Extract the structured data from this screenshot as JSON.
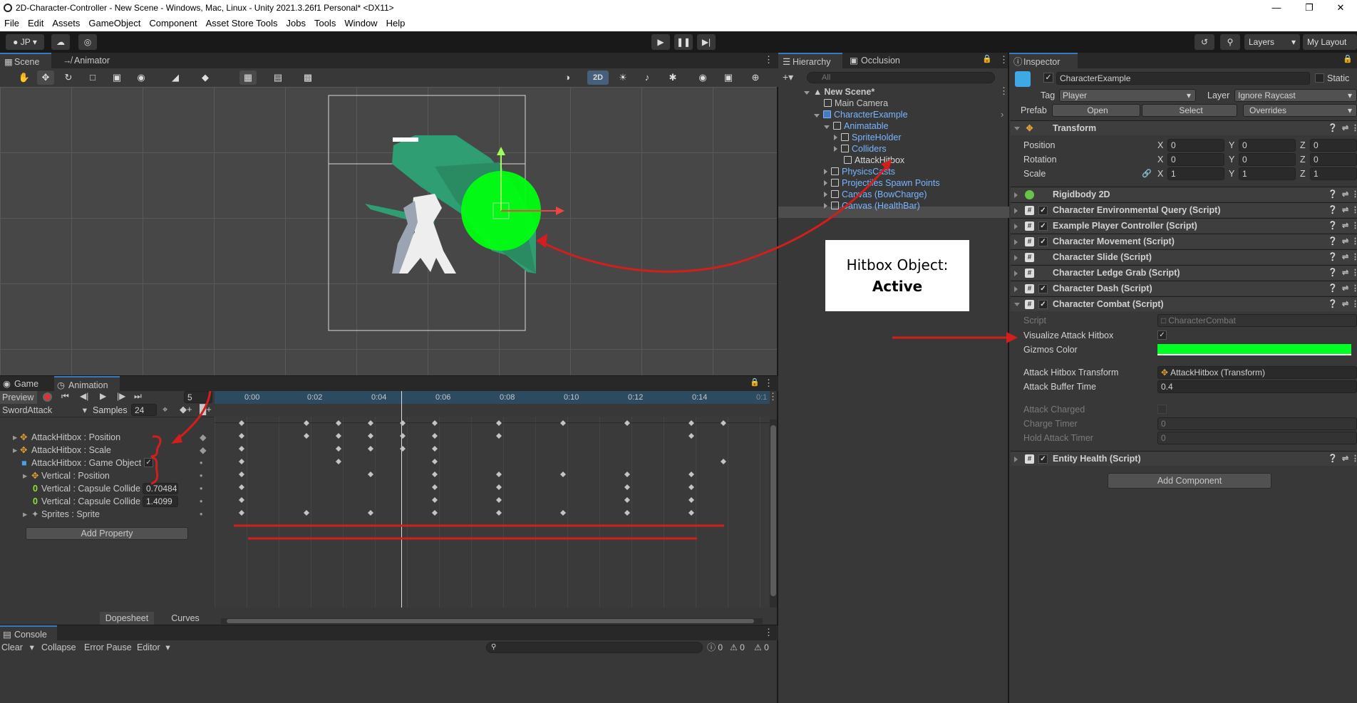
{
  "window": {
    "title": "2D-Character-Controller - New Scene - Windows, Mac, Linux - Unity 2021.3.26f1 Personal* <DX11>"
  },
  "menu": [
    "File",
    "Edit",
    "Assets",
    "GameObject",
    "Component",
    "Asset Store Tools",
    "Jobs",
    "Tools",
    "Window",
    "Help"
  ],
  "toolbar": {
    "account": "JP",
    "layers": "Layers",
    "layout": "My Layout"
  },
  "scene_tabs": {
    "scene": "Scene",
    "animator": "Animator",
    "mode_2d": "2D"
  },
  "hierarchy": {
    "tab": "Hierarchy",
    "tab2": "Occlusion",
    "search_placeholder": "All",
    "items": [
      {
        "label": "New Scene*"
      },
      {
        "label": "Main Camera"
      },
      {
        "label": "CharacterExample"
      },
      {
        "label": "Animatable"
      },
      {
        "label": "SpriteHolder"
      },
      {
        "label": "Colliders"
      },
      {
        "label": "AttackHitbox"
      },
      {
        "label": "PhysicsCasts"
      },
      {
        "label": "Projectiles Spawn Points"
      },
      {
        "label": "Canvas (BowCharge)"
      },
      {
        "label": "Canvas (HealthBar)"
      }
    ]
  },
  "annotation": {
    "line1": "Hitbox Object:",
    "line2": "Active"
  },
  "inspector": {
    "tab": "Inspector",
    "object_name": "CharacterExample",
    "static": "Static",
    "tag_label": "Tag",
    "tag_value": "Player",
    "layer_label": "Layer",
    "layer_value": "Ignore Raycast",
    "prefab_label": "Prefab",
    "open": "Open",
    "select": "Select",
    "overrides": "Overrides",
    "transform": {
      "title": "Transform",
      "position": {
        "label": "Position",
        "x": "0",
        "y": "0",
        "z": "0"
      },
      "rotation": {
        "label": "Rotation",
        "x": "0",
        "y": "0",
        "z": "0"
      },
      "scale": {
        "label": "Scale",
        "x": "1",
        "y": "1",
        "z": "1"
      },
      "axes": [
        "X",
        "Y",
        "Z"
      ]
    },
    "components": [
      "Rigidbody 2D",
      "Character Environmental Query (Script)",
      "Example Player Controller (Script)",
      "Character Movement (Script)",
      "Character Slide (Script)",
      "Character Ledge Grab (Script)",
      "Character Dash (Script)",
      "Character Combat (Script)",
      "Entity Health (Script)"
    ],
    "combat": {
      "script_label": "Script",
      "script_value": "CharacterCombat",
      "visualize_label": "Visualize Attack Hitbox",
      "gizmos_label": "Gizmos Color",
      "gizmos_color": "#00ff22",
      "hitbox_transform_label": "Attack Hitbox Transform",
      "hitbox_transform_value": "AttackHitbox (Transform)",
      "buffer_label": "Attack Buffer Time",
      "buffer_value": "0.4",
      "charged_label": "Attack Charged",
      "charge_timer_label": "Charge Timer",
      "charge_timer_value": "0",
      "hold_timer_label": "Hold Attack Timer",
      "hold_timer_value": "0"
    },
    "add_component": "Add Component"
  },
  "animation": {
    "tab_game": "Game",
    "tab_anim": "Animation",
    "preview": "Preview",
    "frame": "5",
    "clip": "SwordAttack",
    "samples_label": "Samples",
    "samples": "24",
    "times": [
      "0:00",
      "0:02",
      "0:04",
      "0:06",
      "0:08",
      "0:10",
      "0:12",
      "0:14",
      "0:1"
    ],
    "properties": [
      {
        "label": "AttackHitbox : Position",
        "value": ""
      },
      {
        "label": "AttackHitbox : Scale",
        "value": ""
      },
      {
        "label": "AttackHitbox : Game Object",
        "value": ""
      },
      {
        "label": "Vertical : Position",
        "value": ""
      },
      {
        "label": "Vertical : Capsule Collide",
        "value": "0.70484"
      },
      {
        "label": "Vertical : Capsule Collide",
        "value": "1.4099"
      },
      {
        "label": "Sprites : Sprite",
        "value": ""
      }
    ],
    "add_property": "Add Property",
    "dopesheet": "Dopesheet",
    "curves": "Curves"
  },
  "console": {
    "tab": "Console",
    "clear": "Clear",
    "collapse": "Collapse",
    "error_pause": "Error Pause",
    "editor": "Editor",
    "count_info": "0",
    "count_warn": "0",
    "count_err": "0"
  }
}
